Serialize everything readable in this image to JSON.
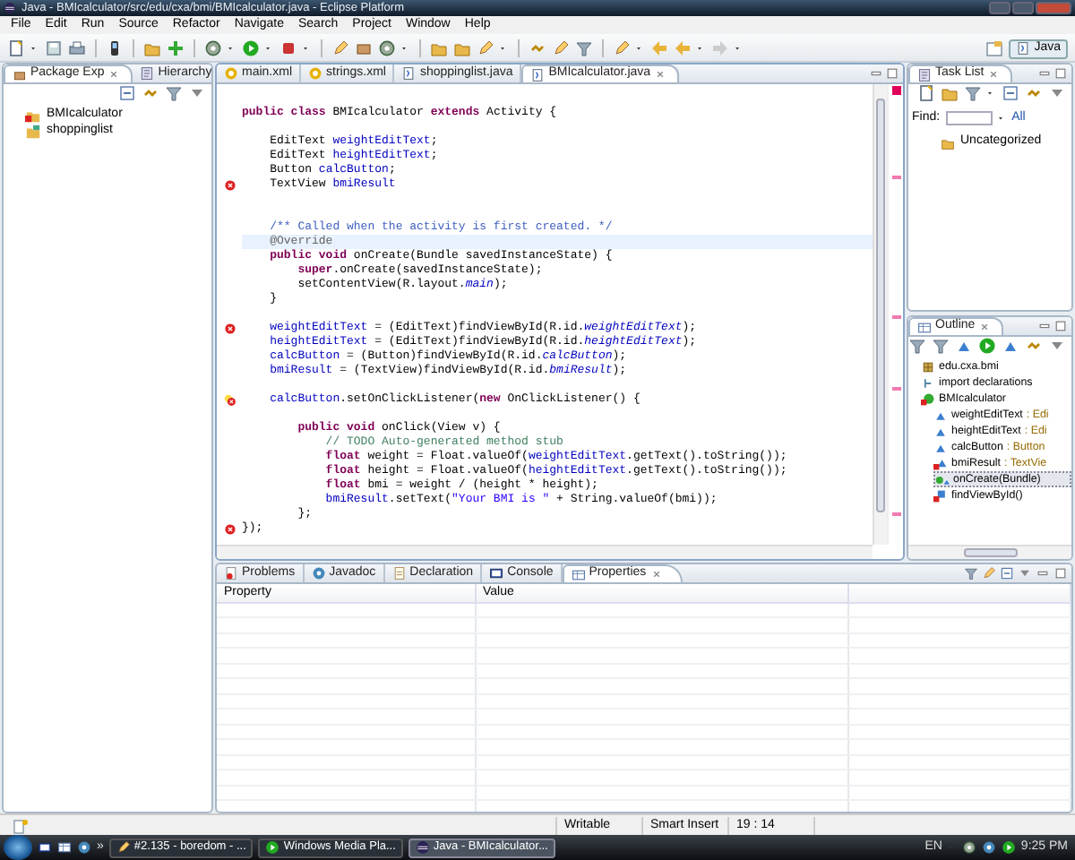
{
  "window": {
    "title": "Java - BMIcalculator/src/edu/cxa/bmi/BMIcalculator.java - Eclipse Platform"
  },
  "menu": [
    "File",
    "Edit",
    "Run",
    "Source",
    "Refactor",
    "Navigate",
    "Search",
    "Project",
    "Window",
    "Help"
  ],
  "toolbar": {
    "perspective": {
      "label": "Java",
      "selected": true
    }
  },
  "package_explorer": {
    "tabs": [
      {
        "label": "Package Exp",
        "selected": true
      },
      {
        "label": "Hierarchy",
        "selected": false
      }
    ],
    "projects": [
      {
        "label": "BMIcalculator",
        "has_errors": true
      },
      {
        "label": "shoppinglist",
        "has_errors": false
      }
    ]
  },
  "editor": {
    "tabs": [
      {
        "label": "main.xml",
        "kind": "xml",
        "selected": false
      },
      {
        "label": "strings.xml",
        "kind": "xml",
        "selected": false
      },
      {
        "label": "shoppinglist.java",
        "kind": "java",
        "selected": false
      },
      {
        "label": "BMIcalculator.java",
        "kind": "java",
        "selected": true
      }
    ],
    "lines": [
      {
        "error": false,
        "quick_fix": false,
        "current": false,
        "tokens": [
          {
            "kind": "keyword",
            "text": "public class "
          },
          {
            "kind": "plain",
            "text": "BMIcalculator "
          },
          {
            "kind": "keyword",
            "text": "extends "
          },
          {
            "kind": "plain",
            "text": "Activity {"
          }
        ]
      },
      {
        "error": false,
        "quick_fix": false,
        "current": false
      },
      {
        "error": false,
        "quick_fix": false,
        "current": false,
        "tokens": [
          {
            "kind": "plain",
            "text": "    EditText "
          },
          {
            "kind": "field",
            "text": "weightEditText"
          },
          {
            "kind": "plain",
            "text": ";"
          }
        ]
      },
      {
        "error": false,
        "quick_fix": false,
        "current": false,
        "tokens": [
          {
            "kind": "plain",
            "text": "    EditText "
          },
          {
            "kind": "field",
            "text": "heightEditText"
          },
          {
            "kind": "plain",
            "text": ";"
          }
        ]
      },
      {
        "error": false,
        "quick_fix": false,
        "current": false,
        "tokens": [
          {
            "kind": "plain",
            "text": "    Button "
          },
          {
            "kind": "field",
            "text": "calcButton"
          },
          {
            "kind": "plain",
            "text": ";"
          }
        ]
      },
      {
        "error": true,
        "quick_fix": false,
        "current": false,
        "tokens": [
          {
            "kind": "plain",
            "text": "    TextView "
          },
          {
            "kind": "field",
            "text": "bmiResult"
          }
        ]
      },
      {
        "error": false,
        "quick_fix": false,
        "current": false
      },
      {
        "error": false,
        "quick_fix": false,
        "current": false
      },
      {
        "error": false,
        "quick_fix": false,
        "current": false,
        "tokens": [
          {
            "kind": "javadoc",
            "text": "    /** Called when the activity is first created. */"
          }
        ]
      },
      {
        "error": false,
        "quick_fix": false,
        "current": true,
        "tokens": [
          {
            "kind": "annotation",
            "text": "    @Override"
          }
        ]
      },
      {
        "error": false,
        "quick_fix": false,
        "current": false,
        "tokens": [
          {
            "kind": "keyword",
            "text": "    public void "
          },
          {
            "kind": "plain",
            "text": "onCreate(Bundle savedInstanceState) {"
          }
        ]
      },
      {
        "error": false,
        "quick_fix": false,
        "current": false,
        "tokens": [
          {
            "kind": "keyword",
            "text": "        super"
          },
          {
            "kind": "plain",
            "text": ".onCreate(savedInstanceState);"
          }
        ]
      },
      {
        "error": false,
        "quick_fix": false,
        "current": false,
        "tokens": [
          {
            "kind": "plain",
            "text": "        setContentView(R.layout."
          },
          {
            "kind": "static",
            "text": "main"
          },
          {
            "kind": "plain",
            "text": ");"
          }
        ]
      },
      {
        "error": false,
        "quick_fix": false,
        "current": false,
        "tokens": [
          {
            "kind": "plain",
            "text": "    }"
          }
        ]
      },
      {
        "error": false,
        "quick_fix": false,
        "current": false
      },
      {
        "error": true,
        "quick_fix": false,
        "current": false,
        "tokens": [
          {
            "kind": "field",
            "text": "    weightEditText"
          },
          {
            "kind": "plain",
            "text": " = (EditText)findViewById(R.id."
          },
          {
            "kind": "static",
            "text": "weightEditText"
          },
          {
            "kind": "plain",
            "text": ");"
          }
        ]
      },
      {
        "error": false,
        "quick_fix": false,
        "current": false,
        "tokens": [
          {
            "kind": "field",
            "text": "    heightEditText"
          },
          {
            "kind": "plain",
            "text": " = (EditText)findViewById(R.id."
          },
          {
            "kind": "static",
            "text": "heightEditText"
          },
          {
            "kind": "plain",
            "text": ");"
          }
        ]
      },
      {
        "error": false,
        "quick_fix": false,
        "current": false,
        "tokens": [
          {
            "kind": "field",
            "text": "    calcButton"
          },
          {
            "kind": "plain",
            "text": " = (Button)findViewById(R.id."
          },
          {
            "kind": "static",
            "text": "calcButton"
          },
          {
            "kind": "plain",
            "text": ");"
          }
        ]
      },
      {
        "error": false,
        "quick_fix": false,
        "current": false,
        "tokens": [
          {
            "kind": "field",
            "text": "    bmiResult"
          },
          {
            "kind": "plain",
            "text": " = (TextView)findViewById(R.id."
          },
          {
            "kind": "static",
            "text": "bmiResult"
          },
          {
            "kind": "plain",
            "text": ");"
          }
        ]
      },
      {
        "error": false,
        "quick_fix": false,
        "current": false
      },
      {
        "error": true,
        "quick_fix": true,
        "current": false,
        "tokens": [
          {
            "kind": "field",
            "text": "    calcButton"
          },
          {
            "kind": "plain",
            "text": ".setOnClickListener("
          },
          {
            "kind": "keyword",
            "text": "new "
          },
          {
            "kind": "plain",
            "text": "OnClickListener() {"
          }
        ]
      },
      {
        "error": false,
        "quick_fix": false,
        "current": false
      },
      {
        "error": false,
        "quick_fix": false,
        "current": false,
        "tokens": [
          {
            "kind": "keyword",
            "text": "        public void "
          },
          {
            "kind": "plain",
            "text": "onClick(View v) {"
          }
        ]
      },
      {
        "error": false,
        "quick_fix": false,
        "current": false,
        "tokens": [
          {
            "kind": "comment",
            "text": "            // TODO Auto-generated method stub"
          }
        ]
      },
      {
        "error": false,
        "quick_fix": false,
        "current": false,
        "tokens": [
          {
            "kind": "keyword",
            "text": "            float "
          },
          {
            "kind": "plain",
            "text": "weight = Float.valueOf("
          },
          {
            "kind": "field",
            "text": "weightEditText"
          },
          {
            "kind": "plain",
            "text": ".getText().toString());"
          }
        ]
      },
      {
        "error": false,
        "quick_fix": false,
        "current": false,
        "tokens": [
          {
            "kind": "keyword",
            "text": "            float "
          },
          {
            "kind": "plain",
            "text": "height = Float.valueOf("
          },
          {
            "kind": "field",
            "text": "heightEditText"
          },
          {
            "kind": "plain",
            "text": ".getText().toString());"
          }
        ]
      },
      {
        "error": false,
        "quick_fix": false,
        "current": false,
        "tokens": [
          {
            "kind": "keyword",
            "text": "            float "
          },
          {
            "kind": "plain",
            "text": "bmi = weight / (height * height);"
          }
        ]
      },
      {
        "error": false,
        "quick_fix": false,
        "current": false,
        "tokens": [
          {
            "kind": "field",
            "text": "            bmiResult"
          },
          {
            "kind": "plain",
            "text": ".setText("
          },
          {
            "kind": "string",
            "text": "\"Your BMI is \""
          },
          {
            "kind": "plain",
            "text": " + String.valueOf(bmi));"
          }
        ]
      },
      {
        "error": false,
        "quick_fix": false,
        "current": false,
        "tokens": [
          {
            "kind": "plain",
            "text": "        };"
          }
        ]
      },
      {
        "error": true,
        "quick_fix": false,
        "current": false,
        "tokens": [
          {
            "kind": "plain",
            "text": "});"
          }
        ]
      }
    ]
  },
  "task_list": {
    "tab": "Task List",
    "find_label": "Find:",
    "all_link": "All",
    "items": [
      "Uncategorized"
    ]
  },
  "outline": {
    "tab": "Outline",
    "items": [
      {
        "label": "edu.cxa.bmi",
        "kind": "package",
        "selected": false
      },
      {
        "label": "import declarations",
        "kind": "imports",
        "selected": false
      },
      {
        "label": "BMIcalculator",
        "kind": "class",
        "selected": false,
        "children": [
          {
            "label": "weightEditText",
            "type": ": Edi",
            "kind": "field",
            "selected": false
          },
          {
            "label": "heightEditText",
            "type": ": Edi",
            "kind": "field",
            "selected": false
          },
          {
            "label": "calcButton",
            "type": ": Button",
            "kind": "field",
            "selected": false
          },
          {
            "label": "bmiResult",
            "type": ": TextVie",
            "kind": "field-error",
            "selected": false
          },
          {
            "label": "onCreate(Bundle)",
            "kind": "method",
            "selected": true
          },
          {
            "label": "findViewById()",
            "kind": "method-error",
            "selected": false
          }
        ]
      }
    ]
  },
  "bottom_panel": {
    "tabs": [
      {
        "label": "Problems",
        "selected": false
      },
      {
        "label": "Javadoc",
        "selected": false
      },
      {
        "label": "Declaration",
        "selected": false
      },
      {
        "label": "Console",
        "selected": false
      },
      {
        "label": "Properties",
        "selected": true
      }
    ],
    "columns": [
      "Property",
      "Value"
    ]
  },
  "status_bar": {
    "fields": [
      "Writable",
      "Smart Insert",
      "19 : 14"
    ]
  },
  "taskbar": {
    "more": "»",
    "tasks": [
      {
        "label": "#2.135 - boredom - ...",
        "selected": false
      },
      {
        "label": "Windows Media Pla...",
        "selected": false
      },
      {
        "label": "Java - BMIcalculator...",
        "selected": true
      }
    ],
    "language": "EN",
    "clock": "9:25 PM"
  }
}
